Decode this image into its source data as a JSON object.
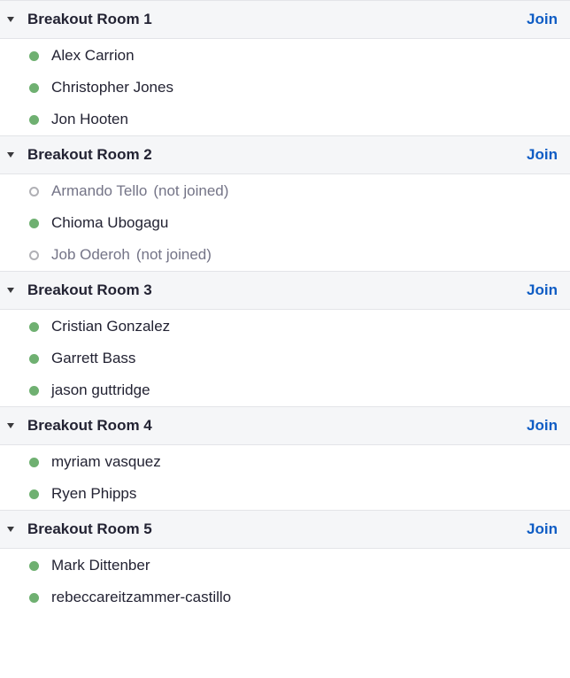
{
  "colors": {
    "header_bg": "#f5f6f8",
    "join_link": "#0e5cc4",
    "joined_dot": "#6fb071",
    "not_joined_text": "#747487",
    "text": "#232333"
  },
  "rooms": [
    {
      "name": "Breakout Room 1",
      "join_label": "Join",
      "members": [
        {
          "name": "Alex Carrion",
          "joined": true,
          "status": ""
        },
        {
          "name": "Christopher Jones",
          "joined": true,
          "status": ""
        },
        {
          "name": "Jon Hooten",
          "joined": true,
          "status": ""
        }
      ]
    },
    {
      "name": "Breakout Room 2",
      "join_label": "Join",
      "members": [
        {
          "name": "Armando Tello",
          "joined": false,
          "status": "(not joined)"
        },
        {
          "name": "Chioma Ubogagu",
          "joined": true,
          "status": ""
        },
        {
          "name": "Job Oderoh",
          "joined": false,
          "status": "(not joined)"
        }
      ]
    },
    {
      "name": "Breakout Room 3",
      "join_label": "Join",
      "members": [
        {
          "name": "Cristian Gonzalez",
          "joined": true,
          "status": ""
        },
        {
          "name": "Garrett Bass",
          "joined": true,
          "status": ""
        },
        {
          "name": "jason guttridge",
          "joined": true,
          "status": ""
        }
      ]
    },
    {
      "name": "Breakout Room 4",
      "join_label": "Join",
      "members": [
        {
          "name": "myriam vasquez",
          "joined": true,
          "status": ""
        },
        {
          "name": "Ryen Phipps",
          "joined": true,
          "status": ""
        }
      ]
    },
    {
      "name": "Breakout Room 5",
      "join_label": "Join",
      "members": [
        {
          "name": "Mark Dittenber",
          "joined": true,
          "status": ""
        },
        {
          "name": "rebeccareitzammer-castillo",
          "joined": true,
          "status": ""
        }
      ]
    }
  ]
}
